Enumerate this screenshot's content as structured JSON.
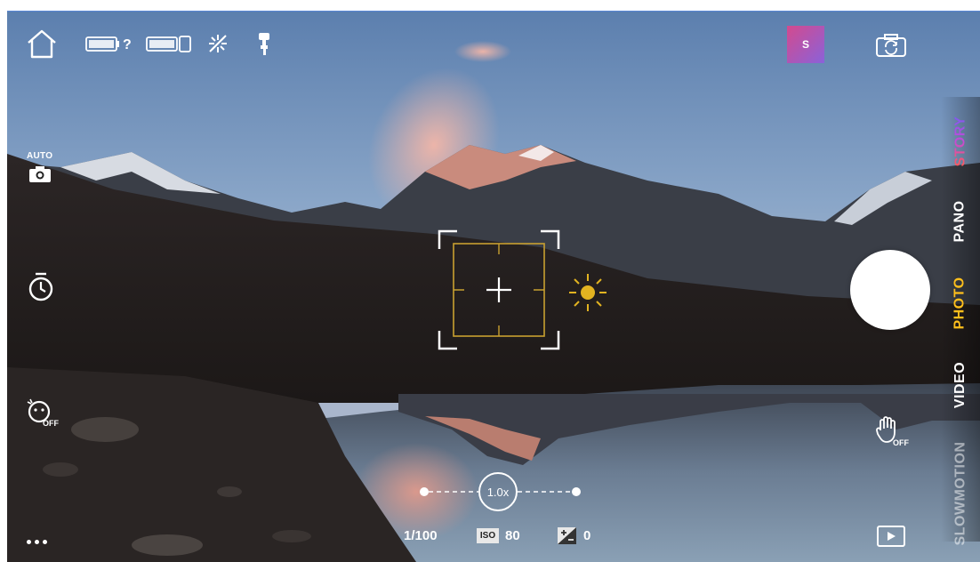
{
  "top_bar": {
    "story_avatar_letter": "S"
  },
  "left_rail": {
    "auto_label": "AUTO"
  },
  "modes": [
    {
      "label": "STORY"
    },
    {
      "label": "PANO"
    },
    {
      "label": "PHOTO"
    },
    {
      "label": "VIDEO"
    },
    {
      "label": "SLOWMOTION"
    }
  ],
  "zoom": {
    "value": "1.0x"
  },
  "exposure": {
    "shutter_speed": "1/100",
    "iso_label": "ISO",
    "iso_value": "80",
    "ev_value": "0"
  },
  "icons": {
    "home": "home-icon",
    "battery_question": "battery-help-icon",
    "battery": "battery-icon",
    "flash_off": "flash-off-icon",
    "gimbal": "gimbal-icon",
    "flip_camera": "flip-camera-icon",
    "auto_camera": "auto-camera-icon",
    "timer": "timer-icon",
    "face_off": "face-tracking-off-icon",
    "gesture_off": "gesture-off-icon",
    "more": "more-dots-icon",
    "playback": "playback-icon",
    "sun": "exposure-sun-icon"
  },
  "colors": {
    "accent_photo": "#ffbf1c",
    "focus_box": "#c8a030"
  }
}
